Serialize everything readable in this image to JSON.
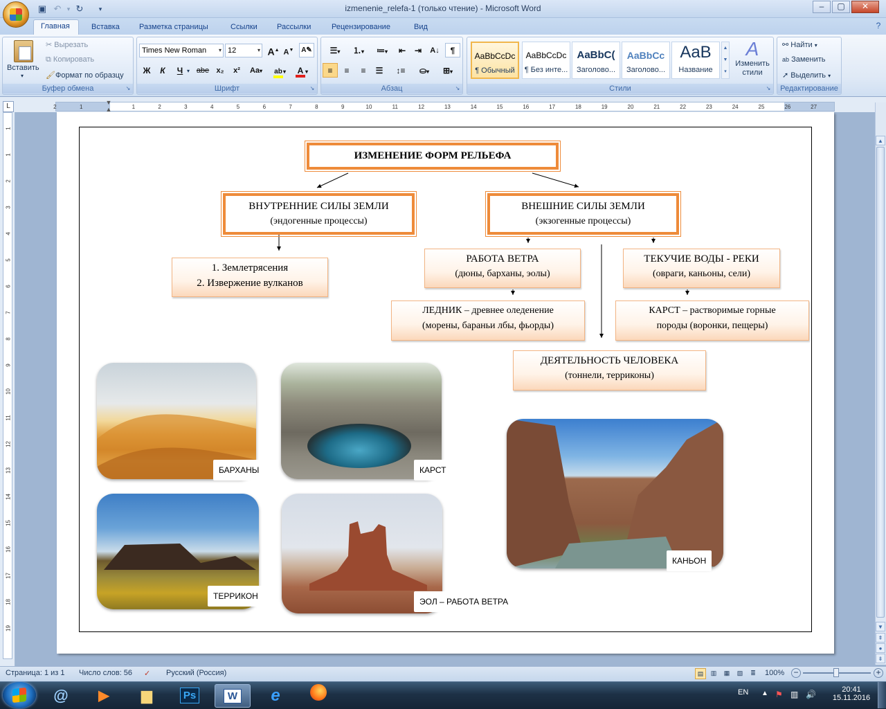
{
  "window": {
    "title": "izmenenie_relefa-1 (только чтение) - Microsoft Word",
    "buttons": {
      "minimize": "‒",
      "maximize": "▢",
      "close": "✕"
    }
  },
  "quick_access": {
    "icons": [
      "save-icon",
      "undo-icon",
      "redo-icon",
      "customize-icon"
    ]
  },
  "tabs": [
    "Главная",
    "Вставка",
    "Разметка страницы",
    "Ссылки",
    "Рассылки",
    "Рецензирование",
    "Вид"
  ],
  "ribbon": {
    "clipboard": {
      "label": "Буфер обмена",
      "paste": "Вставить",
      "cut": "Вырезать",
      "copy": "Копировать",
      "format_painter": "Формат по образцу"
    },
    "font": {
      "label": "Шрифт",
      "font_name": "Times New Roman",
      "font_size": "12",
      "bold": "Ж",
      "italic": "К",
      "underline": "Ч",
      "strike": "abe",
      "subscript": "x₂",
      "superscript": "x²",
      "case": "Aa",
      "grow": "A",
      "shrink": "A",
      "font_color_hex": "#e0201c",
      "highlight_hex": "#ffff00"
    },
    "paragraph": {
      "label": "Абзац"
    },
    "styles": {
      "label": "Стили",
      "items": [
        {
          "preview": "AaBbCcDc",
          "name": "¶ Обычный"
        },
        {
          "preview": "AaBbCcDc",
          "name": "¶ Без инте..."
        },
        {
          "preview": "AaBbC(",
          "name": "Заголово..."
        },
        {
          "preview": "AaBbCc",
          "name": "Заголово..."
        },
        {
          "preview": "AaB",
          "name": "Название"
        }
      ],
      "change_styles": "Изменить стили"
    },
    "editing": {
      "label": "Редактирование",
      "find": "Найти",
      "replace": "Заменить",
      "select": "Выделить"
    }
  },
  "ruler": {
    "labels": [
      "2",
      "1",
      "1",
      "2",
      "3",
      "4",
      "5",
      "6",
      "7",
      "8",
      "9",
      "10",
      "11",
      "12",
      "13",
      "14",
      "15",
      "16",
      "17",
      "18",
      "19",
      "20",
      "21",
      "22",
      "23",
      "24",
      "25",
      "26",
      "27"
    ],
    "vlabels": [
      "1",
      "1",
      "2",
      "3",
      "4",
      "5",
      "6",
      "7",
      "8",
      "9",
      "10",
      "11",
      "12",
      "13",
      "14",
      "15",
      "16",
      "17",
      "18",
      "19"
    ]
  },
  "diagram": {
    "title": "ИЗМЕНЕНИЕ ФОРМ РЕЛЬЕФА",
    "internal": {
      "line1": "ВНУТРЕННИЕ СИЛЫ ЗЕМЛИ",
      "line2": "(эндогенные процессы)"
    },
    "external": {
      "line1": "ВНЕШНИЕ СИЛЫ ЗЕМЛИ",
      "line2": "(экзогенные процессы)"
    },
    "quakes": {
      "line1": "1. Землетрясения",
      "line2": "2. Извержение вулканов"
    },
    "wind": {
      "line1": "РАБОТА ВЕТРА",
      "line2": "(дюны, барханы, эолы)"
    },
    "rivers": {
      "line1": "ТЕКУЧИЕ ВОДЫ - РЕКИ",
      "line2": "(овраги, каньоны, сели)"
    },
    "glacier": {
      "line1": "ЛЕДНИК – древнее оледенение",
      "line2": "(морены, бараньи лбы, фьорды)"
    },
    "karst": {
      "line1": "КАРСТ – растворимые горные",
      "line2": "породы (воронки, пещеры)"
    },
    "human": {
      "line1": "ДЕЯТЕЛЬНОСТЬ ЧЕЛОВЕКА",
      "line2": "(тоннели, терриконы)"
    },
    "border_color": "#ee8b3a"
  },
  "photos": {
    "barkhans": "БАРХАНЫ",
    "karst": "КАРСТ",
    "terrikon": "ТЕРРИКОН",
    "eol": "ЭОЛ – РАБОТА ВЕТРА",
    "canyon": "КАНЬОН"
  },
  "status": {
    "page": "Страница: 1 из 1",
    "words": "Число слов: 56",
    "language": "Русский (Россия)",
    "zoom": "100%"
  },
  "taskbar": {
    "lang": "EN",
    "time": "20:41",
    "date": "15.11.2016",
    "apps": [
      "Ps",
      "W"
    ]
  }
}
